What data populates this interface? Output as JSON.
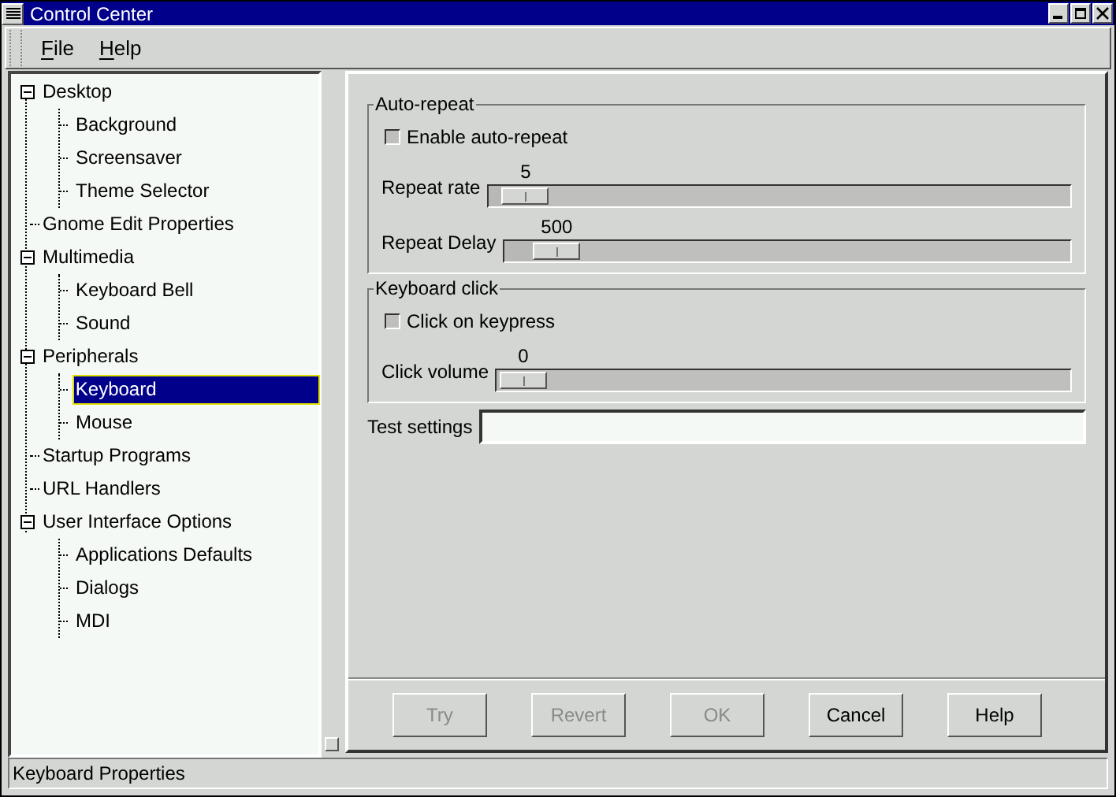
{
  "window": {
    "title": "Control Center"
  },
  "menu": [
    {
      "label": "File"
    },
    {
      "label": "Help"
    }
  ],
  "tree": [
    {
      "label": "Desktop",
      "expanded": true,
      "selected": false,
      "children": [
        {
          "label": "Background",
          "selected": false
        },
        {
          "label": "Screensaver",
          "selected": false
        },
        {
          "label": "Theme Selector",
          "selected": false
        }
      ]
    },
    {
      "label": "Gnome Edit Properties",
      "selected": false
    },
    {
      "label": "Multimedia",
      "expanded": true,
      "selected": false,
      "children": [
        {
          "label": "Keyboard Bell",
          "selected": false
        },
        {
          "label": "Sound",
          "selected": false
        }
      ]
    },
    {
      "label": "Peripherals",
      "expanded": true,
      "selected": false,
      "children": [
        {
          "label": "Keyboard",
          "selected": true
        },
        {
          "label": "Mouse",
          "selected": false
        }
      ]
    },
    {
      "label": "Startup Programs",
      "selected": false
    },
    {
      "label": "URL Handlers",
      "selected": false
    },
    {
      "label": "User Interface Options",
      "expanded": true,
      "selected": false,
      "children": [
        {
          "label": "Applications Defaults",
          "selected": false
        },
        {
          "label": "Dialogs",
          "selected": false
        },
        {
          "label": "MDI",
          "selected": false
        }
      ]
    }
  ],
  "groups": [
    {
      "title": "Auto-repeat",
      "checkbox": {
        "label": "Enable auto-repeat",
        "checked": false
      },
      "sliders": [
        {
          "label": "Repeat rate",
          "reading": "5",
          "level": 0.02
        },
        {
          "label": "Repeat Delay",
          "reading": "500",
          "level": 0.05
        }
      ]
    },
    {
      "title": "Keyboard click",
      "checkbox": {
        "label": "Click on keypress",
        "checked": false
      },
      "sliders": [
        {
          "label": "Click volume",
          "reading": "0",
          "level": 0
        }
      ]
    }
  ],
  "test_field": {
    "label": "Test settings"
  },
  "buttons": [
    {
      "label": "Try",
      "disabled": true
    },
    {
      "label": "Revert",
      "disabled": true
    },
    {
      "label": "OK",
      "disabled": true
    },
    {
      "label": "Cancel",
      "disabled": false
    },
    {
      "label": "Help",
      "disabled": false
    }
  ],
  "status_bar": "Keyboard Properties"
}
